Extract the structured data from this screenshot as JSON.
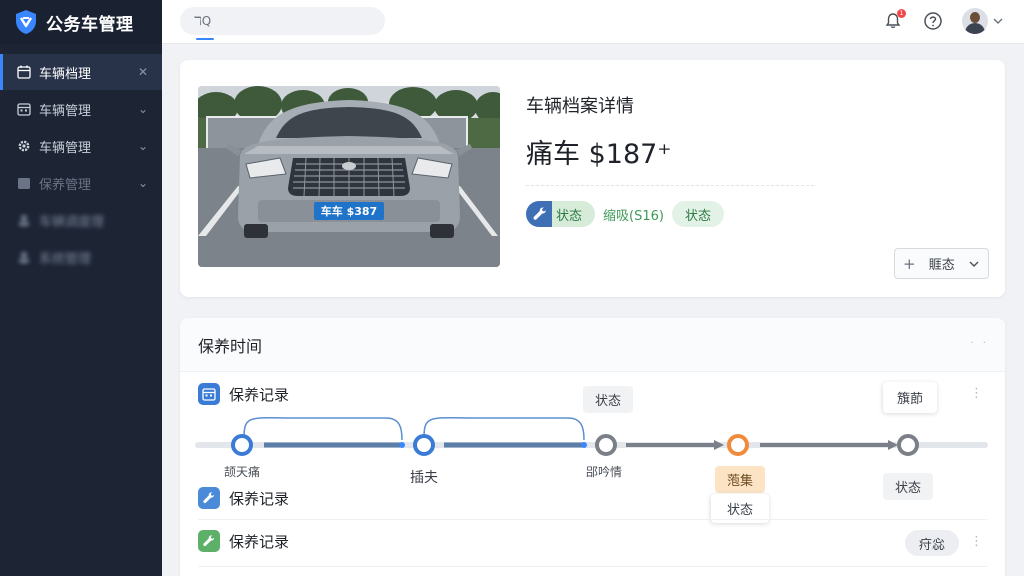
{
  "app": {
    "title": "公务车管理"
  },
  "sidebar": {
    "items": [
      {
        "label": "车辆档理",
        "trail": "✕",
        "active": true
      },
      {
        "label": "车辆管理",
        "trail": "⌄"
      },
      {
        "label": "车辆管理",
        "trail": "⌄"
      },
      {
        "label": "保养管理",
        "trail": "⌄"
      },
      {
        "label": "车辆调度理"
      },
      {
        "label": "系统管理"
      }
    ]
  },
  "header": {
    "search_placeholder": "",
    "notification_count": "1"
  },
  "vehicle": {
    "title": "车辆档案详情",
    "price": "痛车 $187⁺",
    "plate": "车车 $387",
    "tag_status_1": "状态",
    "tag_text": "缩吸(S16)",
    "tag_status_2": "状态",
    "select_label": "䝽态",
    "select_prefix": "+"
  },
  "maintenance": {
    "section_title": "保养时间",
    "records": [
      {
        "label": "保养记录",
        "icon": "calendar-icon"
      },
      {
        "label": "保养记录",
        "icon": "wrench-icon"
      },
      {
        "label": "保养记录",
        "icon": "wrench-icon"
      }
    ],
    "timeline_nodes": [
      {
        "label": "颉天痛"
      },
      {
        "label": "插夫"
      },
      {
        "label": "郘吟情"
      },
      {
        "label": ""
      },
      {
        "label": ""
      }
    ],
    "tips": {
      "node3": "状态",
      "node5_top": "籏莭",
      "node5_bottom": "状态",
      "node4_top": "萢集",
      "node4_bottom": "状态"
    },
    "row3_pill": "疛惢"
  },
  "colors": {
    "accent": "#3a86ff",
    "sidebar": "#1d2535",
    "green": "#5cb068",
    "orange": "#f08a3c"
  }
}
